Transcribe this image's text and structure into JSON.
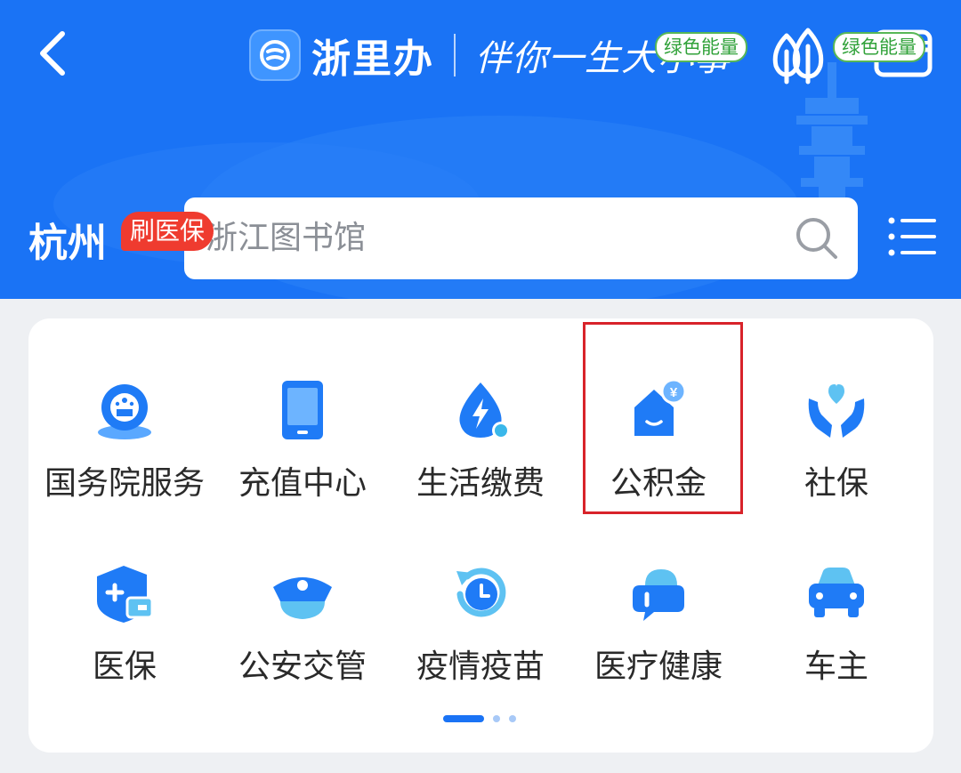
{
  "header": {
    "app_name": "浙里办",
    "slogan": "伴你一生大小事",
    "icons": [
      "back-icon",
      "tree-icon",
      "wallet-icon"
    ]
  },
  "location": {
    "city": "杭州"
  },
  "search": {
    "placeholder": "浙江图书馆"
  },
  "services": [
    {
      "label": "国务院服务",
      "icon": "state-council-icon"
    },
    {
      "label": "充值中心",
      "icon": "tablet-icon"
    },
    {
      "label": "生活缴费",
      "icon": "utility-drop-icon"
    },
    {
      "label": "公积金",
      "icon": "housing-fund-icon",
      "badge": "绿色能量"
    },
    {
      "label": "社保",
      "icon": "social-security-icon",
      "badge": "绿色能量"
    },
    {
      "label": "医保",
      "icon": "medical-insurance-icon",
      "badge": "刷医保"
    },
    {
      "label": "公安交管",
      "icon": "police-cap-icon"
    },
    {
      "label": "疫情疫苗",
      "icon": "vaccine-clock-icon"
    },
    {
      "label": "医疗健康",
      "icon": "health-chat-icon"
    },
    {
      "label": "车主",
      "icon": "car-icon"
    }
  ],
  "pager": {
    "total": 3,
    "active": 1
  },
  "colors": {
    "primary": "#1a73f5",
    "badge_green": "#31a23a",
    "badge_red": "#ef3b2f",
    "highlight": "#d8232a"
  }
}
